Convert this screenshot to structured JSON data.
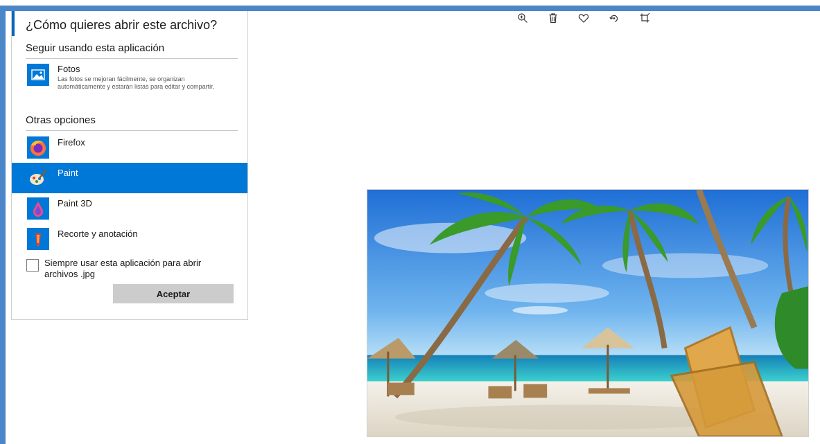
{
  "dialog": {
    "title": "¿Cómo quieres abrir este archivo?",
    "keep_using_heading": "Seguir usando esta aplicación",
    "other_options_heading": "Otras opciones",
    "current_app": {
      "name": "Fotos",
      "description": "Las fotos se mejoran fácilmente, se organizan automáticamente y estarán listas para editar y compartir.",
      "icon": "photos-icon"
    },
    "other_apps": [
      {
        "name": "Firefox",
        "icon": "firefox-icon",
        "selected": false
      },
      {
        "name": "Paint",
        "icon": "paint-icon",
        "selected": true
      },
      {
        "name": "Paint 3D",
        "icon": "paint-3d-icon",
        "selected": false
      },
      {
        "name": "Recorte y anotación",
        "icon": "snip-sketch-icon",
        "selected": false
      }
    ],
    "always_use_label": "Siempre usar esta aplicación para abrir archivos .jpg",
    "always_use_checked": false,
    "accept_label": "Aceptar"
  },
  "toolbar": {
    "buttons": [
      {
        "icon": "zoom-in-icon"
      },
      {
        "icon": "delete-icon"
      },
      {
        "icon": "favorite-heart-icon"
      },
      {
        "icon": "rotate-icon"
      },
      {
        "icon": "crop-icon"
      }
    ]
  },
  "colors": {
    "frame": "#4a86c8",
    "selection": "#0078d7",
    "accent": "#0067c0",
    "button": "#cccccc"
  }
}
